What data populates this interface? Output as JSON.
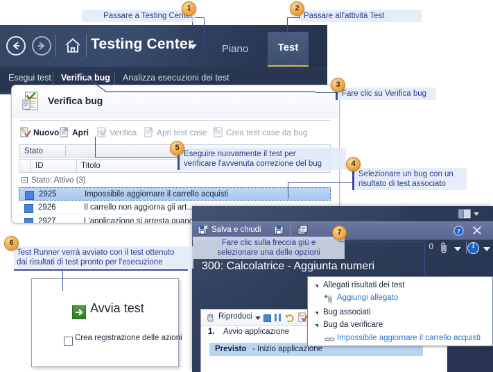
{
  "app": {
    "title": "Testing Center",
    "nav": {
      "back_icon": "back-arrow-icon",
      "forward_icon": "forward-arrow-icon",
      "home_icon": "home-icon"
    },
    "tabs": [
      {
        "key": "plan",
        "label": "Piano",
        "active": false
      },
      {
        "key": "test",
        "label": "Test",
        "active": true
      }
    ],
    "subnav": [
      {
        "key": "esegui",
        "label": "Esegui test",
        "active": false
      },
      {
        "key": "verifica",
        "label": "Verifica bug",
        "active": true
      },
      {
        "key": "analizza",
        "label": "Analizza esecuzioni dei test",
        "active": false
      }
    ]
  },
  "verify_panel": {
    "heading": "Verifica bug",
    "toolbar": [
      {
        "key": "nuovo",
        "label": "Nuovo",
        "icon": "new-bug-icon",
        "enabled": true
      },
      {
        "key": "apri",
        "label": "Apri",
        "icon": "open-document-icon",
        "enabled": true
      },
      {
        "key": "verifica",
        "label": "Verifica",
        "icon": "verify-bug-icon",
        "enabled": false
      },
      {
        "key": "apri_test_case",
        "label": "Apri test case",
        "icon": "open-document-icon",
        "enabled": false
      },
      {
        "key": "crea_test_case",
        "label": "Crea test case da bug",
        "icon": "create-testcase-icon",
        "enabled": false
      }
    ],
    "filter_label": "Stato",
    "columns": [
      "",
      "ID",
      "Titolo"
    ],
    "group_row": "Stato: Attivo (3)",
    "rows": [
      {
        "id": "2925",
        "title": "Impossibile aggiornare il carrello acquisti",
        "selected": true
      },
      {
        "id": "2926",
        "title": "Il carrello non aggiorna gli art...",
        "selected": false
      },
      {
        "id": "2927",
        "title": "L'applicazione si arresta quando...",
        "selected": false
      }
    ]
  },
  "runner": {
    "title": "300: Calcolatrice - Aggiunta numeri",
    "save_and_close": "Salva e chiudi",
    "save_icon": "save-and-close-icon",
    "save2_icon": "save-icon",
    "refresh_icon": "refresh-icon",
    "help_icon": "help-icon",
    "close_icon": "close-icon",
    "layout_icon": "layout-panes-icon",
    "attachment_count": "0",
    "attachment_icon": "paperclip-icon",
    "attachment_caret_icon": "chevron-down-icon",
    "info_icon": "info-icon",
    "info_caret_icon": "chevron-down-icon",
    "playback": {
      "play_label": "Riproduci",
      "play_icon": "play-hand-icon",
      "play_caret_icon": "chevron-down-icon",
      "stop_icon": "stop-icon",
      "pause_icon": "pause-icon",
      "undo_icon": "undo-icon",
      "bug_icon": "create-bug-icon"
    },
    "steps": [
      {
        "num": "1.",
        "text": "Avvio applicazione"
      }
    ],
    "expected_label": "Previsto",
    "expected_text": "- Inizio applicazione"
  },
  "dropdown": {
    "items": [
      {
        "key": "allegati",
        "label": "Allegati risultati dei test",
        "type": "group",
        "icon": "triangle-collapse-icon"
      },
      {
        "key": "aggiungi",
        "label": "Aggiungi allegato",
        "type": "link",
        "icon": "add-attachment-icon"
      },
      {
        "key": "bug_associati",
        "label": "Bug associati",
        "type": "group",
        "icon": "triangle-collapse-icon"
      },
      {
        "key": "bug_da_verificare",
        "label": "Bug da verificare",
        "type": "group",
        "icon": "triangle-collapse-icon"
      },
      {
        "key": "bug_link",
        "label": "Impossibile aggiornare il carrello acquisti",
        "type": "link",
        "icon": "link-icon"
      }
    ]
  },
  "start_card": {
    "button_label": "Avvia test",
    "button_icon": "start-test-arrow-icon",
    "checkbox_label": "Crea registrazione delle azioni",
    "checkbox_checked": false
  },
  "callouts": [
    {
      "n": "1",
      "text": "Passare a Testing Center"
    },
    {
      "n": "2",
      "text": "Passare all'attività Test"
    },
    {
      "n": "3",
      "text": "Fare clic su Verifica bug"
    },
    {
      "n": "4",
      "text": "Selezionare un bug con un\nrisultato di test associato"
    },
    {
      "n": "5",
      "text": "Eseguire nuovamente il test per\nverificare l'avvenuta correzione del bug"
    },
    {
      "n": "6",
      "text": "Test Runner verrà avviato con il test ottenuto\ndai risultati di test pronto per l'esecuzione"
    },
    {
      "n": "7",
      "text": "Fare clic sulla freccia giù e\nselezionare una delle opzioni"
    }
  ],
  "colors": {
    "shell_dark": "#2f3f5c",
    "accent_yellow": "#e0b23c",
    "callout_blue": "#2b3a8c",
    "badge_orange": "#f0ab4a",
    "selection_blue": "#b9d4f2"
  }
}
